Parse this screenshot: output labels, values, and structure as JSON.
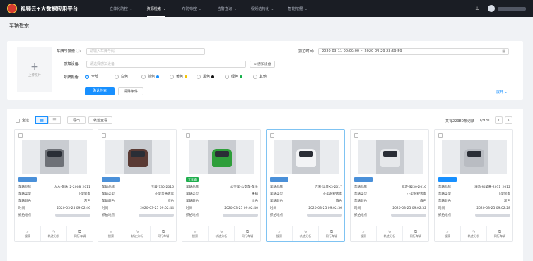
{
  "header": {
    "brand_title": "视频云+大数据应用平台",
    "nav": [
      {
        "label": "立体化防控"
      },
      {
        "label": "资源检索",
        "active": true
      },
      {
        "label": "布防布控"
      },
      {
        "label": "告警查询"
      },
      {
        "label": "视频结构化"
      },
      {
        "label": "智能挖掘"
      }
    ],
    "user_name": "zhaoli.am"
  },
  "page_title": "车辆检索",
  "search": {
    "upload_label": "上传照片",
    "plate_label": "车牌号搜索",
    "plate_placeholder": "请输入车牌号码",
    "device_label": "感知设备",
    "device_placeholder": "请选择感知设备",
    "device_button": "感知设备",
    "color_label": "号牌颜色",
    "color_options": [
      {
        "label": "全部",
        "selected": true,
        "swatch": null
      },
      {
        "label": "白色",
        "selected": false,
        "swatch": null
      },
      {
        "label": "蓝色",
        "selected": false,
        "swatch": "#1890ff"
      },
      {
        "label": "黄色",
        "selected": false,
        "swatch": "#f5c400"
      },
      {
        "label": "黑色",
        "selected": false,
        "swatch": "#111111"
      },
      {
        "label": "绿色",
        "selected": false,
        "swatch": "#16b14a"
      },
      {
        "label": "其他",
        "selected": false,
        "swatch": null
      }
    ],
    "time_label": "抓拍时间",
    "time_value": "2020-03-11 00:00:00 ~ 2020-04-29 23:59:59",
    "confirm_button": "确认检索",
    "clear_button": "清除条件",
    "expand_link": "展开"
  },
  "toolbar": {
    "select_all": "全选",
    "export": "导出",
    "track": "轨迹查看",
    "total_text": "共有22980条记录",
    "page_text": "1/920"
  },
  "field_labels": {
    "brand": "车辆品牌",
    "type": "车辆类型",
    "color": "车辆颜色",
    "time": "时间",
    "place": "抓拍地点"
  },
  "card_actions": [
    {
      "label": "搜索",
      "icon": "search-icon"
    },
    {
      "label": "轨迹分析",
      "icon": "trajectory-icon"
    },
    {
      "label": "同行车辆",
      "icon": "companion-car-icon"
    }
  ],
  "cards": [
    {
      "plate": "",
      "tag_color": "#4a90d9",
      "car_color": "#6e7177",
      "brand": "大众-朗逸_2-2008_2011",
      "type": "小型轿车",
      "color": "灰色",
      "time": "2020-03-25 09:02:46",
      "selected": false
    },
    {
      "plate": "",
      "tag_color": "#4a90d9",
      "car_color": "#5a3a34",
      "brand": "宝骏-730-2016",
      "type": "小型普通客车",
      "color": "棕色",
      "time": "2020-03-25 09:02:44",
      "selected": false
    },
    {
      "plate": "大车辆",
      "tag_color": "#1eae4d",
      "car_color": "#2e9e3a",
      "brand": "公交车-公交车-车头",
      "type": "未知",
      "color": "绿色",
      "time": "2020-03-25 09:02:40",
      "selected": false
    },
    {
      "plate": "",
      "tag_color": "#4a90d9",
      "car_color": "#f2f3f5",
      "brand": "吉利-远景X3-2017",
      "type": "小型越野客车",
      "color": "白色",
      "time": "2020-03-25 09:02:36",
      "selected": true
    },
    {
      "plate": "",
      "tag_color": "#4a90d9",
      "car_color": "#e6e8eb",
      "brand": "双环-S230-2016",
      "type": "小型越野客车",
      "color": "白色",
      "time": "2020-03-25 09:02:32",
      "selected": false
    },
    {
      "plate": "",
      "tag_color": "#1890ff",
      "car_color": "#b9bcc2",
      "brand": "海马-福美来-2011_2012",
      "type": "小型轿车",
      "color": "灰色",
      "time": "2020-03-25 09:02:28",
      "selected": false
    }
  ]
}
